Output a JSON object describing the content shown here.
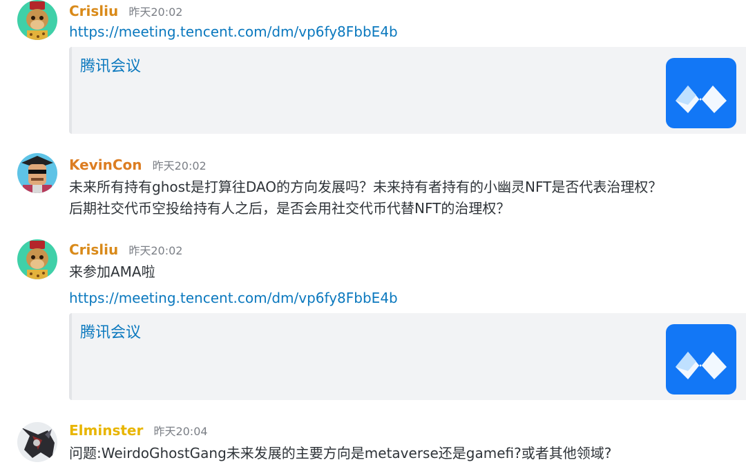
{
  "colors": {
    "link": "#0a78be",
    "crisliu_name": "#d98a1a",
    "kevincon_name": "#dc7d22",
    "elminster_name": "#e8b500",
    "timestamp": "#7b7f86",
    "embed_bg": "#f2f3f5",
    "meeting_logo_bg": "#1277f6"
  },
  "messages": [
    {
      "author": "Crisliu",
      "timestamp": "昨天20:02",
      "avatar_icon": "ape-avatar",
      "lines": [],
      "link": "https://meeting.tencent.com/dm/vp6fy8FbbE4b",
      "embed": {
        "title": "腾讯会议",
        "thumbnail_icon": "tencent-meeting-logo"
      }
    },
    {
      "author": "KevinCon",
      "timestamp": "昨天20:02",
      "avatar_icon": "graduate-avatar",
      "lines": [
        "未来所有持有ghost是打算往DAO的方向发展吗？未来持有者持有的小幽灵NFT是否代表治理权？",
        "后期社交代币空投给持有人之后，是否会用社交代币代替NFT的治理权？"
      ]
    },
    {
      "author": "Crisliu",
      "timestamp": "昨天20:02",
      "avatar_icon": "ape-avatar",
      "lines": [
        "来参加AMA啦"
      ],
      "link": "https://meeting.tencent.com/dm/vp6fy8FbbE4b",
      "embed": {
        "title": "腾讯会议",
        "thumbnail_icon": "tencent-meeting-logo"
      }
    },
    {
      "author": "Elminster",
      "timestamp": "昨天20:04",
      "avatar_icon": "dark-character-avatar",
      "lines": [
        "问题:WeirdoGhostGang未来发展的主要方向是metaverse还是gamefi?或者其他领域?"
      ]
    }
  ]
}
